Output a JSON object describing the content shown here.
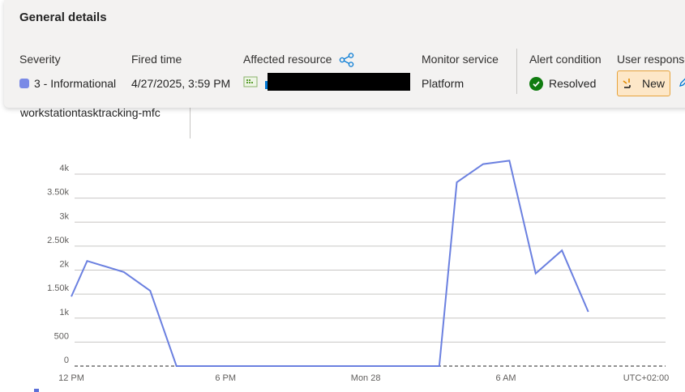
{
  "card": {
    "title": "General details",
    "severity": {
      "label": "Severity",
      "value": "3 - Informational",
      "color": "#7a8ae6"
    },
    "fired_time": {
      "label": "Fired time",
      "value": "4/27/2025, 3:59 PM"
    },
    "affected_resource": {
      "label": "Affected resource",
      "share_icon": "share-icon",
      "resource_icon": "resource-icon"
    },
    "monitor_service": {
      "label": "Monitor service",
      "value": "Platform"
    },
    "alert_condition": {
      "label": "Alert condition",
      "value": "Resolved",
      "color": "#107c10"
    },
    "user_response": {
      "label": "User response",
      "value": "New",
      "icon": "edit-icon"
    }
  },
  "left_panel": {
    "resource_name": "workstationtasktracking-mfc"
  },
  "chart_data": {
    "type": "line",
    "series": [
      {
        "color": "#6b80e0",
        "x": [
          0,
          0.45,
          1.5,
          2.25,
          3.0,
          10.0,
          10.5,
          11.0,
          11.75,
          12.5,
          13.25,
          14.0,
          14.75
        ],
        "values": [
          1450,
          2190,
          1960,
          1570,
          0,
          0,
          0,
          3830,
          4210,
          4280,
          1930,
          2410,
          1130
        ]
      }
    ],
    "x_ticks": [
      {
        "label": "12 PM",
        "x": 0
      },
      {
        "label": "6 PM",
        "x": 4.4
      },
      {
        "label": "Mon 28",
        "x": 8.4
      },
      {
        "label": "6 AM",
        "x": 12.4
      },
      {
        "label": "UTC+02:00",
        "x": 16.4
      }
    ],
    "y_ticks": [
      "0",
      "500",
      "1k",
      "1.50k",
      "2k",
      "2.50k",
      "3k",
      "3.50k",
      "4k"
    ],
    "ylim": [
      0,
      4000
    ],
    "grid": true
  }
}
